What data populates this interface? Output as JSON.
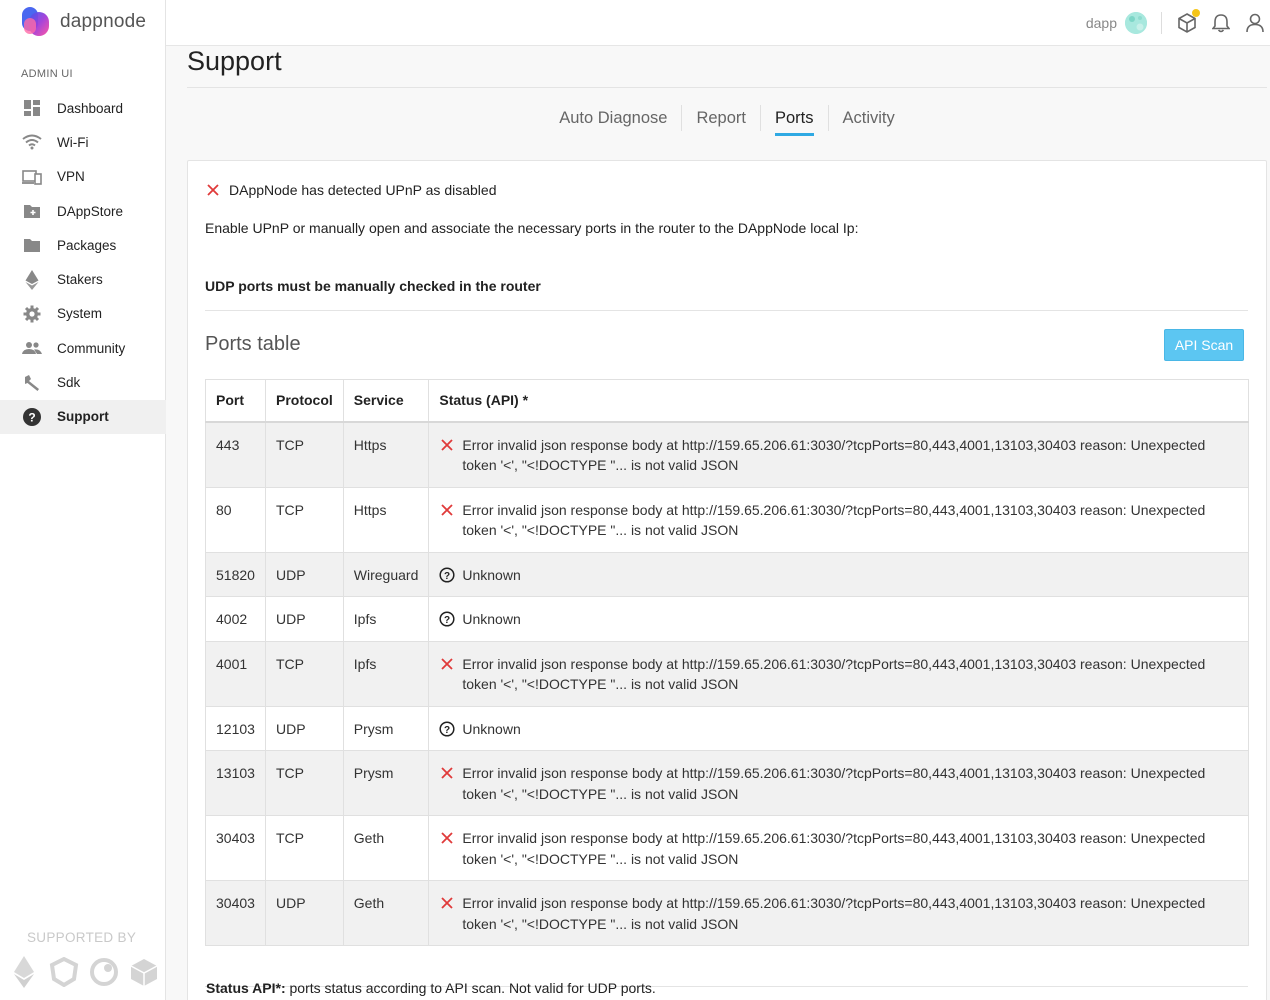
{
  "brand": {
    "name": "dappnode"
  },
  "sidebar": {
    "section_label": "ADMIN UI",
    "items": [
      {
        "label": "Dashboard",
        "icon": "dashboard-icon"
      },
      {
        "label": "Wi-Fi",
        "icon": "wifi-icon"
      },
      {
        "label": "VPN",
        "icon": "vpn-icon"
      },
      {
        "label": "DAppStore",
        "icon": "dappstore-icon"
      },
      {
        "label": "Packages",
        "icon": "folder-icon"
      },
      {
        "label": "Stakers",
        "icon": "ethereum-icon"
      },
      {
        "label": "System",
        "icon": "gear-icon"
      },
      {
        "label": "Community",
        "icon": "people-icon"
      },
      {
        "label": "Sdk",
        "icon": "wrench-icon"
      },
      {
        "label": "Support",
        "icon": "help-icon",
        "active": true
      }
    ],
    "supported_by": "SUPPORTED BY"
  },
  "topbar": {
    "dapp_name": "dapp",
    "notification_dot_color": "#f5c518"
  },
  "page": {
    "title": "Support",
    "tabs": [
      {
        "label": "Auto Diagnose"
      },
      {
        "label": "Report"
      },
      {
        "label": "Ports",
        "active": true
      },
      {
        "label": "Activity"
      }
    ]
  },
  "card": {
    "alert_text": "DAppNode has detected UPnP as disabled",
    "help_text": "Enable UPnP or manually open and associate the necessary ports in the router to the DAppNode local Ip:",
    "udp_warning": "UDP ports must be manually checked in the router",
    "ports_title": "Ports table",
    "api_scan_label": "API Scan",
    "table": {
      "headers": [
        "Port",
        "Protocol",
        "Service",
        "Status (API) *"
      ],
      "rows": [
        {
          "port": "443",
          "protocol": "TCP",
          "service": "Https",
          "status": "error",
          "status_text": "Error invalid json response body at http://159.65.206.61:3030/?tcpPorts=80,443,4001,13103,30403 reason: Unexpected token '<', \"<!DOCTYPE \"... is not valid JSON"
        },
        {
          "port": "80",
          "protocol": "TCP",
          "service": "Https",
          "status": "error",
          "status_text": "Error invalid json response body at http://159.65.206.61:3030/?tcpPorts=80,443,4001,13103,30403 reason: Unexpected token '<', \"<!DOCTYPE \"... is not valid JSON"
        },
        {
          "port": "51820",
          "protocol": "UDP",
          "service": "Wireguard",
          "status": "unknown",
          "status_text": "Unknown"
        },
        {
          "port": "4002",
          "protocol": "UDP",
          "service": "Ipfs",
          "status": "unknown",
          "status_text": "Unknown"
        },
        {
          "port": "4001",
          "protocol": "TCP",
          "service": "Ipfs",
          "status": "error",
          "status_text": "Error invalid json response body at http://159.65.206.61:3030/?tcpPorts=80,443,4001,13103,30403 reason: Unexpected token '<', \"<!DOCTYPE \"... is not valid JSON"
        },
        {
          "port": "12103",
          "protocol": "UDP",
          "service": "Prysm",
          "status": "unknown",
          "status_text": "Unknown"
        },
        {
          "port": "13103",
          "protocol": "TCP",
          "service": "Prysm",
          "status": "error",
          "status_text": "Error invalid json response body at http://159.65.206.61:3030/?tcpPorts=80,443,4001,13103,30403 reason: Unexpected token '<', \"<!DOCTYPE \"... is not valid JSON"
        },
        {
          "port": "30403",
          "protocol": "TCP",
          "service": "Geth",
          "status": "error",
          "status_text": "Error invalid json response body at http://159.65.206.61:3030/?tcpPorts=80,443,4001,13103,30403 reason: Unexpected token '<', \"<!DOCTYPE \"... is not valid JSON"
        },
        {
          "port": "30403",
          "protocol": "UDP",
          "service": "Geth",
          "status": "error",
          "status_text": "Error invalid json response body at http://159.65.206.61:3030/?tcpPorts=80,443,4001,13103,30403 reason: Unexpected token '<', \"<!DOCTYPE \"... is not valid JSON"
        }
      ]
    },
    "footnote_label": "Status API*:",
    "footnote_text": " ports status according to API scan. Not valid for UDP ports."
  },
  "colors": {
    "accent": "#2fa9e3",
    "error": "#e03a3a",
    "api_button": "#5cc6f2"
  }
}
